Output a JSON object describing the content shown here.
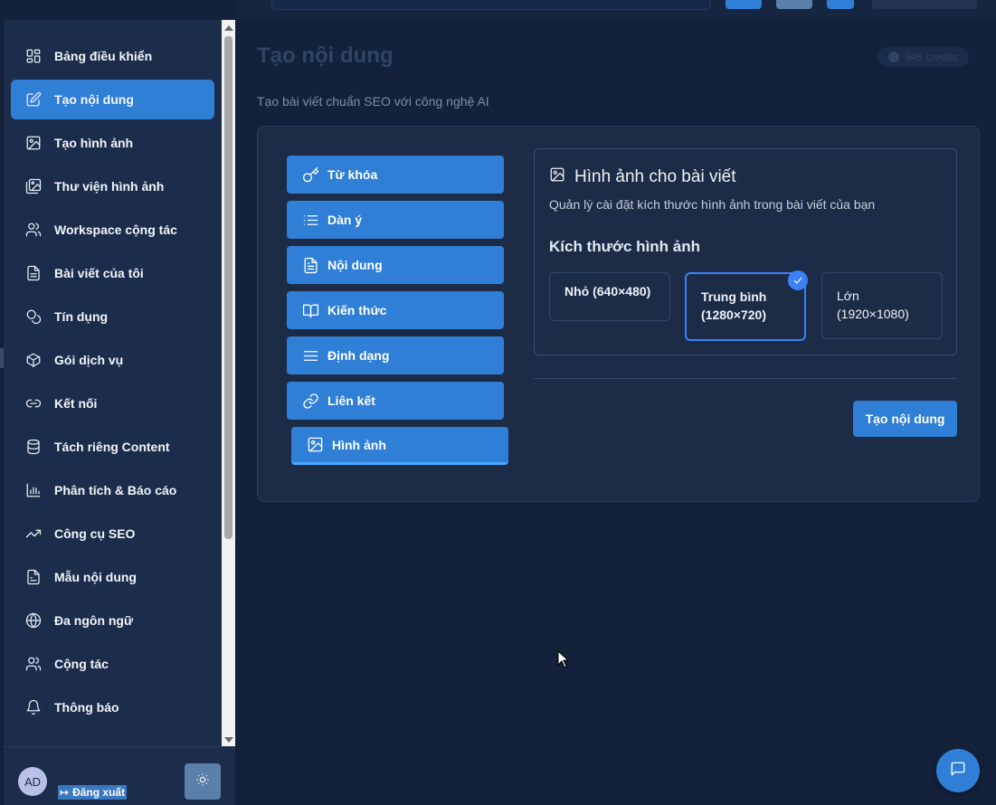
{
  "sidebar": {
    "items": [
      {
        "label": "Bảng điều khiển",
        "icon": "dashboard-icon",
        "active": false
      },
      {
        "label": "Tạo nội dung",
        "icon": "edit-icon",
        "active": true
      },
      {
        "label": "Tạo hình ảnh",
        "icon": "image-icon",
        "active": false
      },
      {
        "label": "Thư viện hình ảnh",
        "icon": "image-library-icon",
        "active": false
      },
      {
        "label": "Workspace cộng tác",
        "icon": "users-icon",
        "active": false
      },
      {
        "label": "Bài viết của tôi",
        "icon": "document-icon",
        "active": false
      },
      {
        "label": "Tín dụng",
        "icon": "coins-icon",
        "active": false
      },
      {
        "label": "Gói dịch vụ",
        "icon": "package-icon",
        "active": false
      },
      {
        "label": "Kết nối",
        "icon": "link-icon",
        "active": false
      },
      {
        "label": "Tách riêng Content",
        "icon": "database-icon",
        "active": false
      },
      {
        "label": "Phân tích & Báo cáo",
        "icon": "bar-chart-icon",
        "active": false
      },
      {
        "label": "Công cụ SEO",
        "icon": "trending-up-icon",
        "active": false
      },
      {
        "label": "Mẫu nội dung",
        "icon": "template-icon",
        "active": false
      },
      {
        "label": "Đa ngôn ngữ",
        "icon": "globe-icon",
        "active": false
      },
      {
        "label": "Cộng tác",
        "icon": "users-icon",
        "active": false
      },
      {
        "label": "Thông báo",
        "icon": "bell-icon",
        "active": false
      }
    ],
    "footer": {
      "avatar_initials": "AD",
      "logout_label": "Đăng xuất"
    }
  },
  "header": {
    "title": "Tạo nội dung",
    "credits": "945 credits",
    "subtitle": "Tạo bài viết chuẩn SEO với công nghệ AI"
  },
  "steps": [
    {
      "label": "Từ khóa",
      "icon": "key-icon"
    },
    {
      "label": "Dàn ý",
      "icon": "list-icon"
    },
    {
      "label": "Nội dung",
      "icon": "file-text-icon"
    },
    {
      "label": "Kiến thức",
      "icon": "book-icon"
    },
    {
      "label": "Định dạng",
      "icon": "align-icon"
    },
    {
      "label": "Liên kết",
      "icon": "link-icon"
    },
    {
      "label": "Hình ảnh",
      "icon": "image-icon",
      "active": true
    }
  ],
  "panel": {
    "title": "Hình ảnh cho bài viết",
    "description": "Quản lý cài đặt kích thước hình ảnh trong bài viết của bạn",
    "size_heading": "Kích thước hình ảnh",
    "options": [
      {
        "line1": "Nhỏ (640×480)",
        "line2": "",
        "selected": false
      },
      {
        "line1": "Trung bình",
        "line2": "(1280×720)",
        "selected": true
      },
      {
        "line1": "Lớn",
        "line2": "(1920×1080)",
        "selected": false
      }
    ]
  },
  "actions": {
    "submit_label": "Tạo nội dung"
  },
  "colors": {
    "accent": "#2f7fd6",
    "background": "#13213a",
    "sidebar": "#1b2d4b",
    "selected_border": "#3b82f6"
  }
}
